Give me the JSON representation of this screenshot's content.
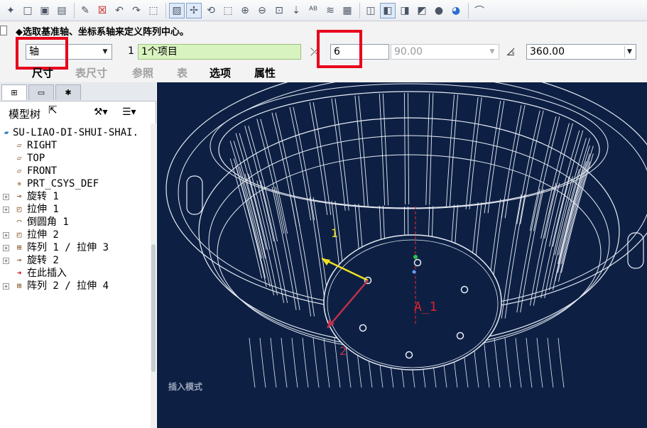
{
  "toolbar": {
    "icons": [
      "new-icon",
      "open-icon",
      "save-icon",
      "save-as-icon",
      "edit-icon",
      "close-window-icon",
      "undo-icon",
      "redo-icon",
      "select-box-icon",
      "repaint-icon",
      "spin-center-icon",
      "orient-icon",
      "refit-icon",
      "zoom-in-icon",
      "zoom-out-icon",
      "zoom-fit-icon",
      "view-manager-icon",
      "text-icon",
      "layers-icon",
      "snapshot-icon",
      "wireframe-icon",
      "hidden-line-icon",
      "no-hidden-icon",
      "shading-icon",
      "appearance-icon",
      "user-icon"
    ]
  },
  "dashboard": {
    "prompt": "选取基准轴、坐标系轴来定义阵列中心。",
    "type_select": "轴",
    "ref_index": "1",
    "ref_value": "1个项目",
    "count_value": "6",
    "angle_increment": "90.00",
    "total_angle": "360.00",
    "tabs": [
      {
        "label": "尺寸",
        "enabled": true
      },
      {
        "label": "表尺寸",
        "enabled": false
      },
      {
        "label": "参照",
        "enabled": false
      },
      {
        "label": "表",
        "enabled": false
      },
      {
        "label": "选项",
        "enabled": true
      },
      {
        "label": "属性",
        "enabled": true
      }
    ]
  },
  "tree": {
    "header": "模型树",
    "nodes": [
      {
        "label": "SU-LIAO-DI-SHUI-SHAI.",
        "icon": "part-icon",
        "expandable": false
      },
      {
        "label": "RIGHT",
        "icon": "datum-plane-icon",
        "expandable": false
      },
      {
        "label": "TOP",
        "icon": "datum-plane-icon",
        "expandable": false
      },
      {
        "label": "FRONT",
        "icon": "datum-plane-icon",
        "expandable": false
      },
      {
        "label": "PRT_CSYS_DEF",
        "icon": "csys-icon",
        "expandable": false
      },
      {
        "label": "旋转 1",
        "icon": "revolve-icon",
        "expandable": true
      },
      {
        "label": "拉伸 1",
        "icon": "extrude-icon",
        "expandable": true
      },
      {
        "label": "倒圆角 1",
        "icon": "round-icon",
        "expandable": false
      },
      {
        "label": "拉伸 2",
        "icon": "extrude-icon",
        "expandable": true
      },
      {
        "label": "阵列 1 / 拉伸 3",
        "icon": "pattern-icon",
        "expandable": true
      },
      {
        "label": "旋转 2",
        "icon": "revolve-icon",
        "expandable": true
      },
      {
        "label": "在此插入",
        "icon": "insert-arrow-icon",
        "expandable": false
      },
      {
        "label": "阵列 2 / 拉伸 4",
        "icon": "pattern-icon",
        "expandable": true
      }
    ]
  },
  "canvas": {
    "axis_label": "A_1",
    "direction_label_1": "2",
    "direction_label_2": "1",
    "mode_text": "插入模式"
  }
}
